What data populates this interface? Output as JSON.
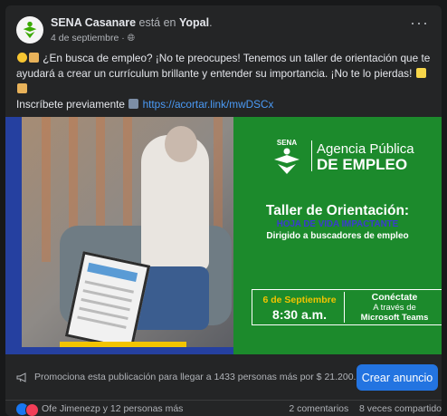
{
  "post": {
    "author": "SENA Casanare",
    "action_text": " está en ",
    "location": "Yopal",
    "date": "4 de septiembre",
    "date_separator": " · ",
    "more_options": "···",
    "body_text": "¿En busca de empleo? ¡No te preocupes! Tenemos un taller de orientación que te ayudará a crear un currículum brillante y entender su importancia. ¡No te lo pierdas!",
    "register_text": "Inscríbete previamente",
    "register_link": "https://acortar.link/mwDSCx"
  },
  "flyer": {
    "agency_line1": "Agencia Pública",
    "agency_line2": "DE EMPLEO",
    "logo_label": "SENA",
    "title": "Taller de Orientación:",
    "subtitle": "HOJA DE VIDA IMPACTANTE",
    "audience": "Dirigido a buscadores de empleo",
    "date": "6 de Septiembre",
    "time": "8:30 a.m.",
    "connect": "Conéctate",
    "via": "A través de",
    "platform": "Microsoft Teams"
  },
  "promo": {
    "text": "Promociona esta publicación para llegar a 1433 personas más por $ 21.200.",
    "button": "Crear anuncio"
  },
  "footer": {
    "reactions_text": "Ofe Jimenezp y 12 personas más",
    "comments": "2 comentarios",
    "shares": "8 veces compartido"
  }
}
